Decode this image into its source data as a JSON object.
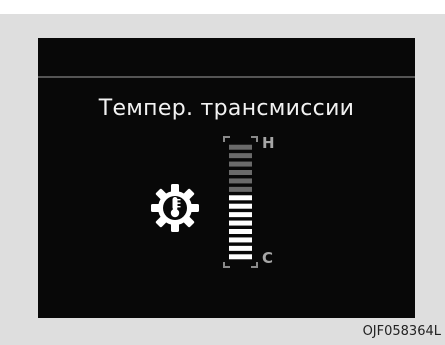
{
  "display": {
    "title": "Темпер. трансмиссии",
    "hot_label": "H",
    "cold_label": "C",
    "gauge": {
      "total_segments": 14,
      "lit_segments": 8,
      "lit_color": "#ffffff",
      "dim_color": "#6a6a6a"
    },
    "icon": "transmission-temperature-icon"
  },
  "figure_code": "OJF058364L",
  "colors": {
    "background": "#dedede",
    "screen": "#080808",
    "divider": "#545454",
    "text": "#f2f2f2",
    "label": "#a6a6a6"
  }
}
